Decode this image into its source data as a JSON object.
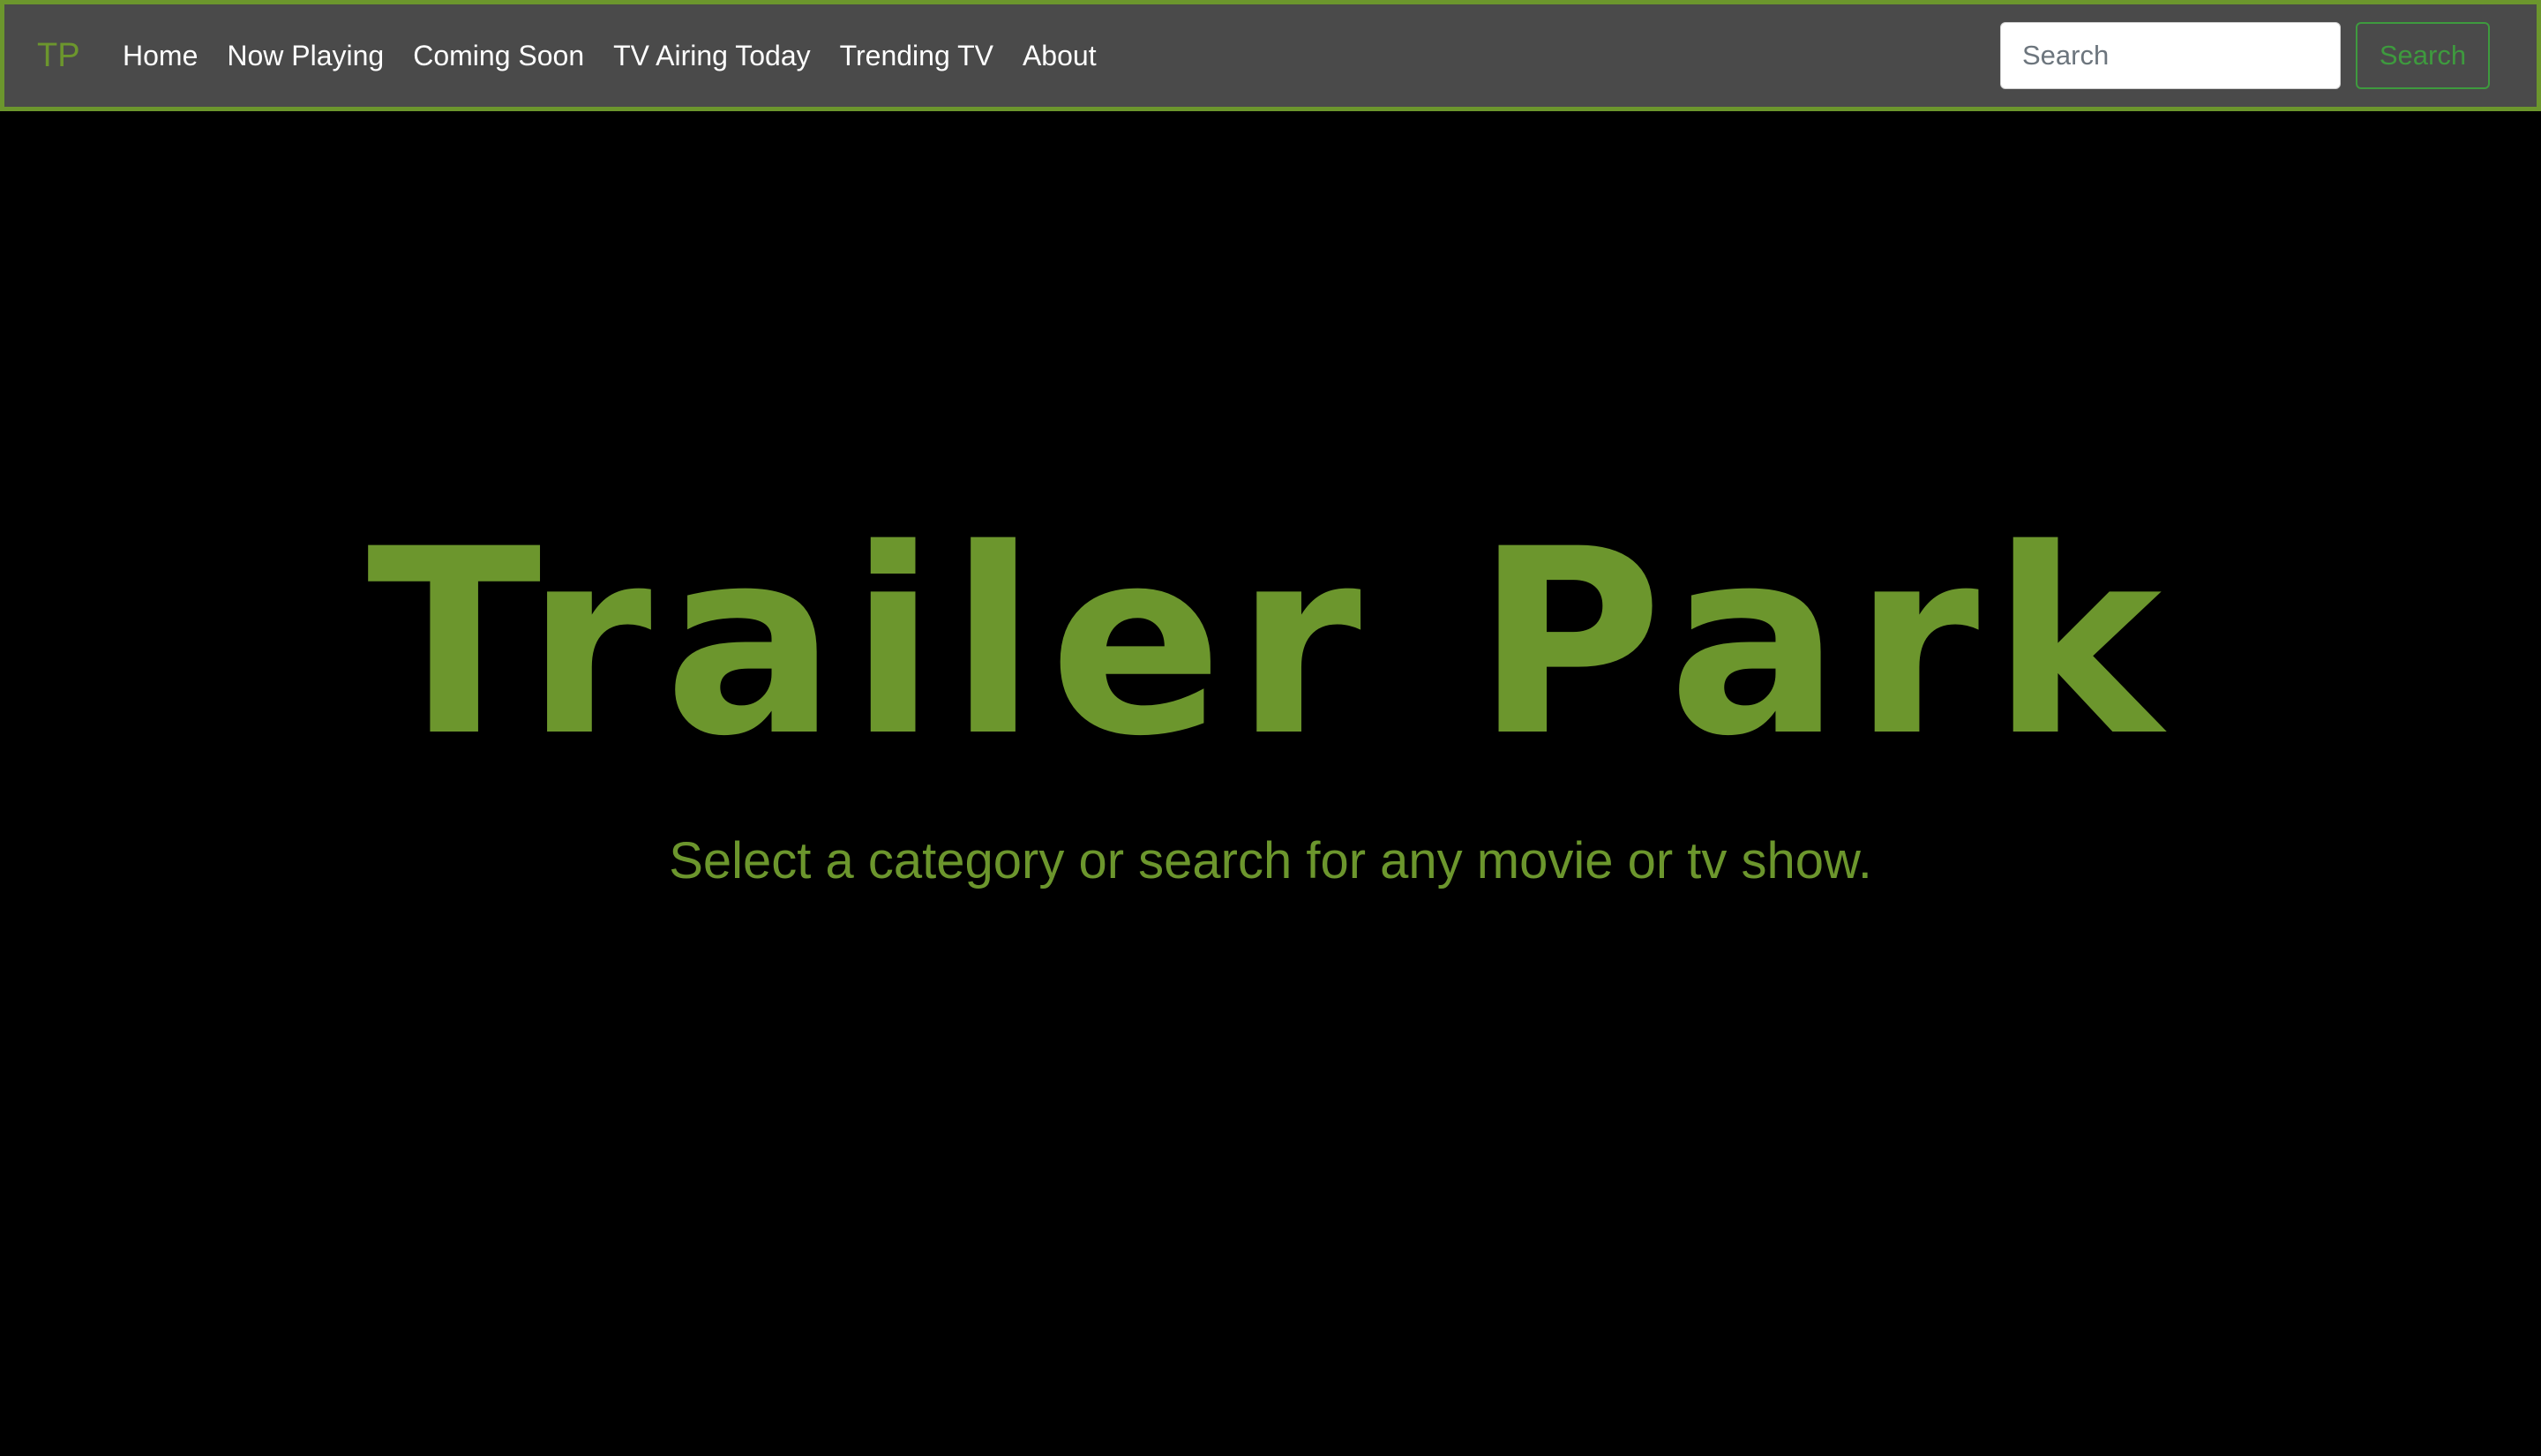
{
  "navbar": {
    "brand": "TP",
    "links": [
      {
        "label": "Home"
      },
      {
        "label": "Now Playing"
      },
      {
        "label": "Coming Soon"
      },
      {
        "label": "TV Airing Today"
      },
      {
        "label": "Trending TV"
      },
      {
        "label": "About"
      }
    ],
    "search": {
      "placeholder": "Search",
      "button_label": "Search"
    }
  },
  "hero": {
    "title": "Trailer Park",
    "subtitle": "Select a category or search for any movie or tv show."
  },
  "colors": {
    "accent": "#6c962d",
    "navbar_bg": "#4a4a4a",
    "page_bg": "#000000",
    "search_button": "#3e9a3e"
  }
}
